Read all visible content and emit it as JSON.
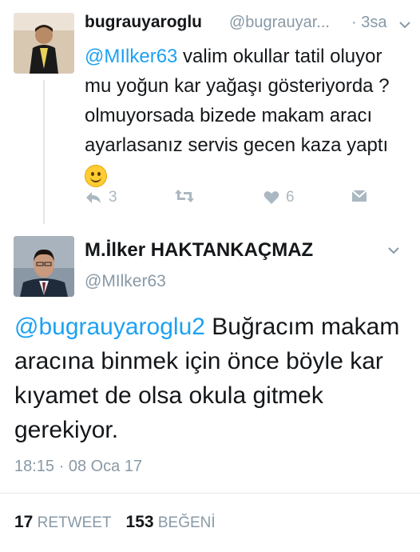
{
  "reply": {
    "name": "bugrauyaroglu",
    "handle": "@bugrauyar...",
    "time": "· 3sa",
    "mention": "@MIlker63",
    "text": " valim okullar tatil oluyor mu yoğun kar yağaşı gösteriyorda ? olmuyorsada bizede makam aracı ayarlasanız servis gecen kaza yaptı",
    "reply_count": "3",
    "like_count": "6"
  },
  "tweet": {
    "name": "M.İlker HAKTANKAÇMAZ",
    "handle": "@MIlker63",
    "mention": "@bugrauyaroglu2",
    "text": " Buğracım makam aracına binmek için önce böyle kar kıyamet de olsa okula gitmek gerekiyor.",
    "date": "18:15 · 08 Oca 17",
    "retweets": "17",
    "retweets_label": "RETWEET",
    "likes": "153",
    "likes_label": "BEĞENİ"
  },
  "colors": {
    "link": "#1da1f2",
    "muted": "#8899a6",
    "icon": "#aab8c2"
  },
  "icons": [
    "reply-icon",
    "retweet-icon",
    "heart-icon",
    "dm-icon",
    "chevron-down-icon",
    "smile-emoji"
  ]
}
